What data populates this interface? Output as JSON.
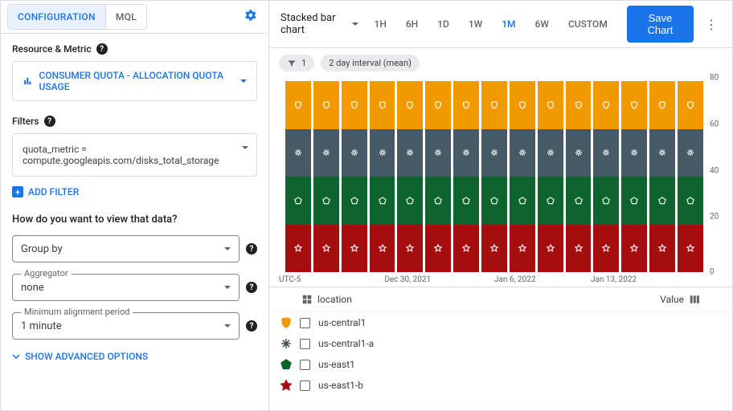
{
  "tabs": {
    "config": "CONFIGURATION",
    "mql": "MQL"
  },
  "resource_metric_label": "Resource & Metric",
  "metric_pill": "CONSUMER QUOTA - ALLOCATION QUOTA USAGE",
  "filters_label": "Filters",
  "filter_text_line1": "quota_metric =",
  "filter_text_line2": "compute.googleapis.com/disks_total_storage",
  "add_filter": "ADD FILTER",
  "view_question": "How do you want to view that data?",
  "group_by_value": "Group by",
  "aggregator_label": "Aggregator",
  "aggregator_value": "none",
  "min_align_label": "Minimum alignment period",
  "min_align_value": "1 minute",
  "advanced": "SHOW ADVANCED OPTIONS",
  "chart_type": "Stacked bar chart",
  "time_ranges": [
    "1H",
    "6H",
    "1D",
    "1W",
    "1M",
    "6W",
    "CUSTOM"
  ],
  "time_active": "1M",
  "save_btn": "Save Chart",
  "filter_chip_count": "1",
  "interval_chip": "2 day interval (mean)",
  "legend_header": "location",
  "legend_value_header": "Value",
  "legend_items": [
    {
      "label": "us-central1",
      "color": "#f29900",
      "shape": "shield"
    },
    {
      "label": "us-central1-a",
      "color": "#455a64",
      "shape": "gear"
    },
    {
      "label": "us-east1",
      "color": "#0d652d",
      "shape": "pentagon"
    },
    {
      "label": "us-east1-b",
      "color": "#a50e0e",
      "shape": "star"
    }
  ],
  "chart_data": {
    "type": "bar",
    "stacked": true,
    "ylim": [
      0,
      80
    ],
    "yticks": [
      0,
      20,
      40,
      60,
      80
    ],
    "x_timezone_label": "UTC-5",
    "x_labels": [
      {
        "pos": 0.3,
        "text": "Dec 30, 2021"
      },
      {
        "pos": 0.55,
        "text": "Jan 6, 2022"
      },
      {
        "pos": 0.78,
        "text": "Jan 13, 2022"
      }
    ],
    "num_bars": 15,
    "series": [
      {
        "name": "us-east1-b",
        "color": "#a50e0e",
        "shape": "star",
        "value_each": 20
      },
      {
        "name": "us-east1",
        "color": "#0d652d",
        "shape": "pentagon",
        "value_each": 20
      },
      {
        "name": "us-central1-a",
        "color": "#455a64",
        "shape": "gear",
        "value_each": 20
      },
      {
        "name": "us-central1",
        "color": "#f29900",
        "shape": "shield",
        "value_each": 20
      }
    ]
  }
}
